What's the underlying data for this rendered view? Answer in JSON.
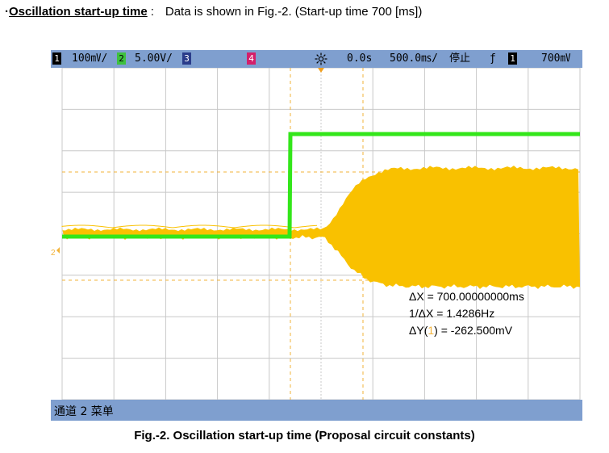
{
  "heading": {
    "bullet": "·",
    "title": "Oscillation start-up time",
    "colon": ":",
    "text": "Data is shown in Fig.-2. (Start-up time 700 [ms])"
  },
  "scope": {
    "status_bar": {
      "ch1_number": "1",
      "ch1_scale": "100㎷/",
      "ch2_number": "2",
      "ch2_scale": "5.00V/",
      "ch3_number": "3",
      "ch4_number": "4",
      "trigger_position": "0.0s",
      "timebase": "500.0㎳/",
      "run_state": "停止",
      "trigger_slope": "ƒ",
      "trigger_source": "1",
      "trigger_level": "700㎷"
    },
    "cursor_readout": {
      "delta_x": "ΔX = 700.00000000ms",
      "inverse_delta_x": "1/ΔX = 1.4286Hz",
      "delta_y_prefix": "ΔY(",
      "delta_y_channel": "1",
      "delta_y_suffix": ") = -262.500mV"
    },
    "ground_marker": "2",
    "softkey_menu": "通道 2 菜单",
    "colors": {
      "ch1_trace": "#f9c100",
      "ch2_trace": "#33e61a",
      "grid": "#c8c8c8",
      "cursor": "#f2b33a",
      "bar": "#7f9fcf"
    }
  },
  "caption": "Fig.-2. Oscillation start-up time (Proposal circuit constants)"
}
